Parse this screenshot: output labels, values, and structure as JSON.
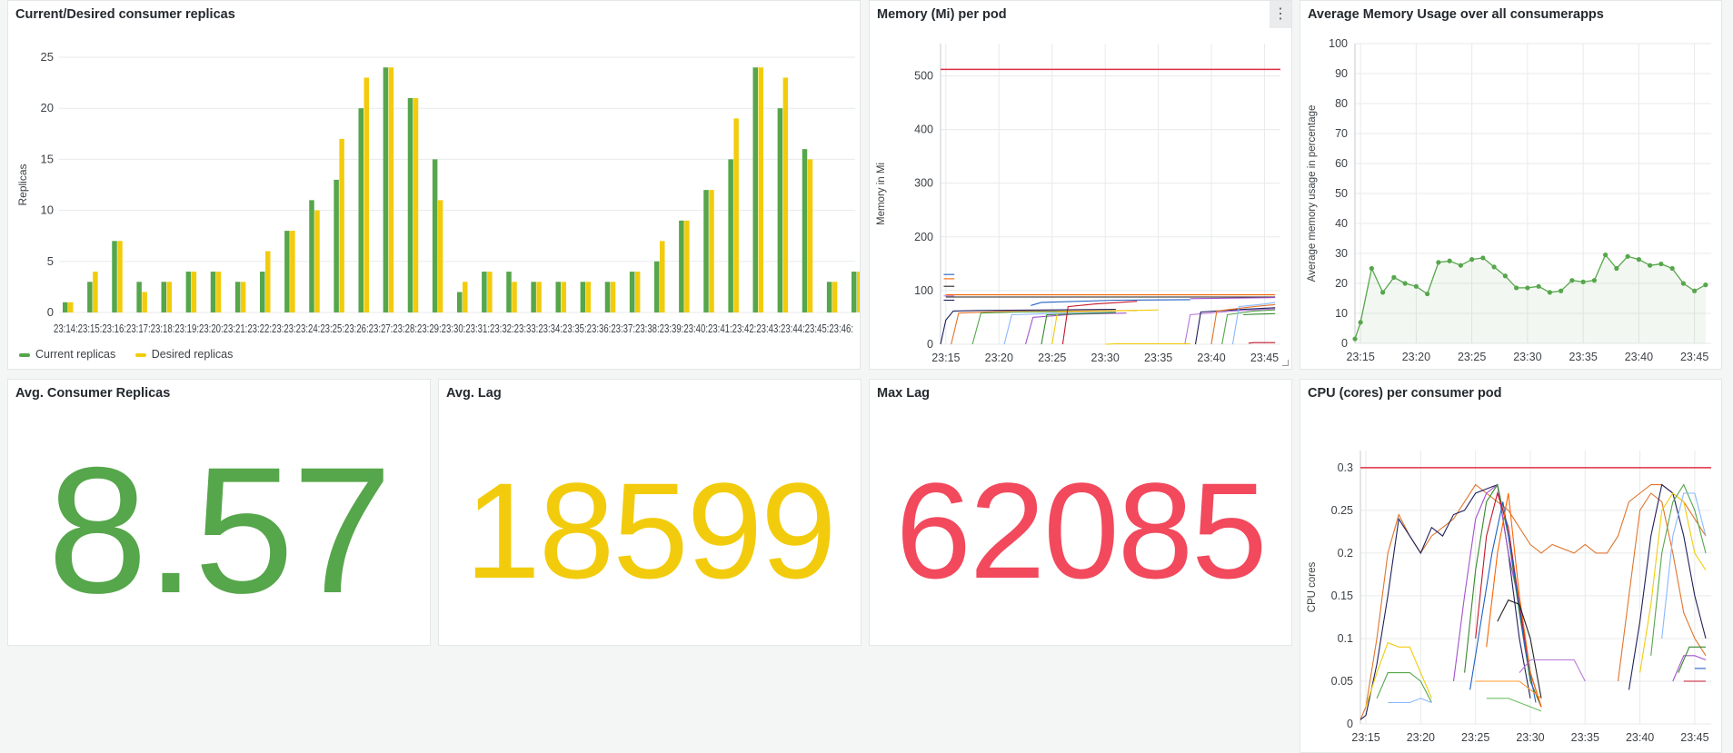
{
  "colors": {
    "green": "#56a64b",
    "yellow": "#f2cc0c",
    "red": "#f2495c",
    "grid": "#e8eaeb",
    "axis_text": "#3d4247"
  },
  "panels": {
    "replicas": {
      "title": "Current/Desired consumer replicas",
      "legend": [
        "Current replicas",
        "Desired replicas"
      ]
    },
    "memory": {
      "title": "Memory (Mi) per pod",
      "menu_icon": "⋮"
    },
    "avg_memory": {
      "title": "Average Memory Usage over all consumerapps"
    },
    "avg_replicas": {
      "title": "Avg. Consumer Replicas",
      "value": "8.57"
    },
    "avg_lag": {
      "title": "Avg. Lag",
      "value": "18599"
    },
    "max_lag": {
      "title": "Max Lag",
      "value": "62085"
    },
    "cpu": {
      "title": "CPU (cores) per consumer pod"
    }
  },
  "chart_data": [
    {
      "type": "bar",
      "title": "Current/Desired consumer replicas",
      "ylabel": "Replicas",
      "ylim": [
        0,
        25
      ],
      "yticks": [
        0,
        5,
        10,
        15,
        20,
        25
      ],
      "categories": [
        "23:14",
        "23:15",
        "23:16",
        "23:17",
        "23:18",
        "23:19",
        "23:20",
        "23:21",
        "23:22",
        "23:23",
        "23:24",
        "23:25",
        "23:26",
        "23:27",
        "23:28",
        "23:29",
        "23:30",
        "23:31",
        "23:32",
        "23:33",
        "23:34",
        "23:35",
        "23:36",
        "23:37",
        "23:38",
        "23:39",
        "23:40",
        "23:41",
        "23:42",
        "23:43",
        "23:44",
        "23:45",
        "23:46"
      ],
      "xtick_text": "23:14:23:15:23:16:23:17:23:18:23:19:23:20:23:21:23:22:23:23:23:24:23:25:23:26:23:27:23:28:23:29:23:30:23:31:23:32:23:33:23:34:23:35:23:36:23:37:23:38:23:39:23:40:23:41:23:42:23:43:23:44:23:45:23:46:",
      "series": [
        {
          "name": "Current replicas",
          "color": "#56a64b",
          "values": [
            1,
            3,
            7,
            3,
            3,
            4,
            4,
            3,
            4,
            8,
            11,
            13,
            20,
            24,
            21,
            15,
            2,
            4,
            4,
            3,
            3,
            3,
            3,
            4,
            5,
            9,
            12,
            15,
            24,
            20,
            16,
            3,
            4
          ]
        },
        {
          "name": "Desired replicas",
          "color": "#f2cc0c",
          "values": [
            1,
            4,
            7,
            2,
            3,
            4,
            4,
            3,
            6,
            8,
            10,
            17,
            23,
            24,
            21,
            11,
            3,
            4,
            3,
            3,
            3,
            3,
            3,
            4,
            7,
            9,
            12,
            19,
            24,
            23,
            15,
            3,
            4
          ]
        }
      ],
      "legend": "bottom-left"
    },
    {
      "type": "line",
      "title": "Memory (Mi) per pod",
      "ylabel": "Memory in Mi",
      "ylim": [
        0,
        560
      ],
      "yticks": [
        0,
        100,
        200,
        300,
        400,
        500
      ],
      "xticks": [
        "23:15",
        "23:20",
        "23:25",
        "23:30",
        "23:35",
        "23:40",
        "23:45"
      ],
      "xrange": [
        14.5,
        46.5
      ],
      "limit_line": {
        "value": 512,
        "color": "#e02f44"
      },
      "series_colors": [
        "#1f1f5c",
        "#e0752d",
        "#56a64b",
        "#8ab8ff",
        "#a352cc",
        "#37872d",
        "#f2cc0c",
        "#c4162a",
        "#1f60c4",
        "#fa6400",
        "#222222",
        "#b877d9"
      ],
      "series": [
        {
          "x": [
            14.5,
            15,
            15.7,
            18,
            25,
            31
          ],
          "y": [
            0,
            45,
            62,
            63,
            64,
            65
          ]
        },
        {
          "x": [
            15.5,
            16.2,
            20,
            27,
            33
          ],
          "y": [
            0,
            58,
            61,
            62,
            63
          ]
        },
        {
          "x": [
            17.5,
            18.3,
            22,
            27
          ],
          "y": [
            0,
            58,
            60,
            61
          ]
        },
        {
          "x": [
            20.5,
            21.2,
            26,
            31
          ],
          "y": [
            0,
            55,
            58,
            60
          ]
        },
        {
          "x": [
            22.5,
            23.2,
            27,
            32
          ],
          "y": [
            0,
            50,
            56,
            58
          ]
        },
        {
          "x": [
            24,
            24.5,
            28,
            31
          ],
          "y": [
            0,
            55,
            57,
            59
          ]
        },
        {
          "x": [
            25,
            25.5,
            30,
            35
          ],
          "y": [
            0,
            60,
            62,
            64
          ]
        },
        {
          "x": [
            26,
            26.5,
            29,
            33
          ],
          "y": [
            0,
            70,
            75,
            80
          ]
        },
        {
          "x": [
            23,
            24,
            31,
            38
          ],
          "y": [
            72,
            78,
            82,
            83
          ]
        },
        {
          "x": [
            15,
            31,
            46
          ],
          "y": [
            92,
            92,
            92
          ]
        },
        {
          "x": [
            15,
            32,
            46
          ],
          "y": [
            88,
            88,
            88
          ]
        },
        {
          "x": [
            37.5,
            38,
            42,
            46
          ],
          "y": [
            0,
            55,
            62,
            66
          ]
        },
        {
          "x": [
            38.5,
            39,
            43,
            46
          ],
          "y": [
            0,
            60,
            65,
            68
          ]
        },
        {
          "x": [
            40,
            40.5,
            44,
            46
          ],
          "y": [
            0,
            62,
            70,
            74
          ]
        },
        {
          "x": [
            41,
            41.5,
            44,
            46
          ],
          "y": [
            0,
            55,
            62,
            64
          ]
        },
        {
          "x": [
            42,
            42.6,
            45,
            46
          ],
          "y": [
            0,
            70,
            75,
            78
          ]
        },
        {
          "x": [
            38,
            42,
            46
          ],
          "y": [
            85,
            86,
            87
          ]
        },
        {
          "x": [
            43,
            44,
            46
          ],
          "y": [
            55,
            56,
            57
          ]
        },
        {
          "x": [
            30,
            31,
            38
          ],
          "y": [
            0,
            1,
            1
          ]
        },
        {
          "x": [
            43.5,
            44,
            46
          ],
          "y": [
            2,
            3,
            3
          ]
        },
        {
          "x": [
            14.8,
            15.8
          ],
          "y": [
            130,
            130
          ]
        },
        {
          "x": [
            14.8,
            15.8
          ],
          "y": [
            122,
            122
          ]
        },
        {
          "x": [
            14.8,
            15.8
          ],
          "y": [
            108,
            108
          ]
        },
        {
          "x": [
            14.8,
            15.8
          ],
          "y": [
            90,
            90
          ]
        },
        {
          "x": [
            14.8,
            15.8
          ],
          "y": [
            82,
            82
          ]
        }
      ]
    },
    {
      "type": "area",
      "title": "Average Memory Usage over all consumerapps",
      "ylabel": "Average memory usage in percentage",
      "ylim": [
        0,
        100
      ],
      "yticks": [
        0,
        10,
        20,
        30,
        40,
        50,
        60,
        70,
        80,
        90,
        100
      ],
      "xticks": [
        "23:15",
        "23:20",
        "23:25",
        "23:30",
        "23:35",
        "23:40",
        "23:45"
      ],
      "xrange": [
        14.5,
        46.5
      ],
      "series": [
        {
          "name": "Average memory usage",
          "color": "#56a64b",
          "x": [
            14.5,
            15,
            16,
            17,
            18,
            19,
            20,
            21,
            22,
            23,
            24,
            25,
            26,
            27,
            28,
            29,
            30,
            31,
            32,
            33,
            34,
            35,
            36,
            37,
            38,
            39,
            40,
            41,
            42,
            43,
            44,
            45,
            46
          ],
          "y": [
            1.5,
            7,
            25,
            17,
            22,
            20,
            19,
            16.5,
            27,
            27.5,
            26,
            28,
            28.5,
            25.5,
            22.5,
            18.5,
            18.5,
            19,
            17,
            17.5,
            21,
            20.5,
            21,
            29.5,
            25,
            29,
            28,
            26,
            26.5,
            25,
            20,
            17.5,
            19.5
          ]
        }
      ]
    },
    {
      "type": "line",
      "title": "CPU (cores) per consumer pod",
      "ylabel": "CPU cores",
      "ylim": [
        0,
        0.32
      ],
      "yticks": [
        0,
        0.05,
        0.1,
        0.15,
        0.2,
        0.25,
        0.3
      ],
      "xticks": [
        "23:15",
        "23:20",
        "23:25",
        "23:30",
        "23:35",
        "23:40",
        "23:45"
      ],
      "xrange": [
        14.5,
        46.5
      ],
      "limit_line": {
        "value": 0.3,
        "color": "#e02f44"
      },
      "series_colors": [
        "#e0752d",
        "#1f1f5c",
        "#f2cc0c",
        "#56a64b",
        "#8ab8ff",
        "#a352cc",
        "#37872d",
        "#c4162a",
        "#1f60c4",
        "#fa6400",
        "#222222",
        "#ff9830",
        "#b877d9",
        "#73bf69"
      ],
      "series": [
        {
          "x": [
            14.5,
            15,
            16,
            17,
            18,
            19,
            20,
            21,
            22,
            23,
            24,
            25,
            26,
            27,
            28,
            29,
            30,
            31,
            32,
            33,
            34,
            35,
            36,
            37,
            38,
            39,
            40,
            41,
            42,
            43,
            44,
            45,
            46
          ],
          "y": [
            0.005,
            0.02,
            0.1,
            0.2,
            0.245,
            0.22,
            0.2,
            0.22,
            0.23,
            0.24,
            0.26,
            0.28,
            0.27,
            0.26,
            0.25,
            0.23,
            0.21,
            0.2,
            0.21,
            0.205,
            0.2,
            0.21,
            0.2,
            0.2,
            0.22,
            0.26,
            0.27,
            0.28,
            0.28,
            0.27,
            0.26,
            0.24,
            0.22
          ]
        },
        {
          "x": [
            14.5,
            15,
            16,
            17,
            18,
            19,
            20,
            21,
            22,
            23,
            24,
            25,
            26,
            27,
            28,
            29,
            30
          ],
          "y": [
            0.005,
            0.01,
            0.07,
            0.15,
            0.24,
            0.22,
            0.2,
            0.23,
            0.22,
            0.245,
            0.25,
            0.27,
            0.275,
            0.28,
            0.2,
            0.1,
            0.03
          ]
        },
        {
          "x": [
            15,
            16,
            17,
            18,
            19,
            20,
            21
          ],
          "y": [
            0.02,
            0.06,
            0.095,
            0.09,
            0.09,
            0.06,
            0.03
          ]
        },
        {
          "x": [
            16,
            17,
            18,
            19,
            20,
            21
          ],
          "y": [
            0.03,
            0.06,
            0.06,
            0.06,
            0.05,
            0.025
          ]
        },
        {
          "x": [
            17,
            18,
            19,
            20,
            21
          ],
          "y": [
            0.025,
            0.025,
            0.025,
            0.03,
            0.025
          ]
        },
        {
          "x": [
            23,
            24,
            25,
            26,
            27,
            28,
            29,
            30,
            31
          ],
          "y": [
            0.05,
            0.15,
            0.24,
            0.27,
            0.28,
            0.2,
            0.14,
            0.05,
            0.02
          ]
        },
        {
          "x": [
            24,
            25,
            26,
            27,
            28,
            29,
            30,
            31
          ],
          "y": [
            0.06,
            0.18,
            0.26,
            0.28,
            0.22,
            0.13,
            0.05,
            0.02
          ]
        },
        {
          "x": [
            25,
            26,
            27,
            28,
            29,
            30,
            31
          ],
          "y": [
            0.1,
            0.22,
            0.27,
            0.23,
            0.14,
            0.06,
            0.02
          ]
        },
        {
          "x": [
            24.5,
            25.5,
            26.5,
            27.5,
            28.5,
            29.5,
            30.5
          ],
          "y": [
            0.04,
            0.12,
            0.2,
            0.26,
            0.18,
            0.09,
            0.025
          ]
        },
        {
          "x": [
            26,
            27,
            28,
            29,
            30,
            31
          ],
          "y": [
            0.09,
            0.2,
            0.27,
            0.15,
            0.06,
            0.02
          ]
        },
        {
          "x": [
            27,
            28,
            29,
            30,
            31
          ],
          "y": [
            0.12,
            0.145,
            0.14,
            0.1,
            0.03
          ]
        },
        {
          "x": [
            25,
            26,
            27,
            28,
            29,
            30,
            31
          ],
          "y": [
            0.05,
            0.05,
            0.05,
            0.05,
            0.05,
            0.04,
            0.03
          ]
        },
        {
          "x": [
            29,
            30,
            31,
            32,
            33,
            34,
            35
          ],
          "y": [
            0.06,
            0.075,
            0.075,
            0.075,
            0.075,
            0.075,
            0.05
          ]
        },
        {
          "x": [
            26,
            27,
            28,
            29,
            30,
            31
          ],
          "y": [
            0.03,
            0.03,
            0.03,
            0.025,
            0.02,
            0.015
          ]
        },
        {
          "x": [
            38,
            39,
            40,
            41,
            42,
            43,
            44,
            45,
            46
          ],
          "y": [
            0.05,
            0.15,
            0.25,
            0.27,
            0.26,
            0.2,
            0.13,
            0.1,
            0.08
          ]
        },
        {
          "x": [
            39,
            40,
            41,
            42,
            43,
            44,
            45,
            46
          ],
          "y": [
            0.04,
            0.12,
            0.22,
            0.28,
            0.27,
            0.22,
            0.15,
            0.1
          ]
        },
        {
          "x": [
            40,
            41,
            42,
            43,
            44,
            45,
            46
          ],
          "y": [
            0.06,
            0.14,
            0.25,
            0.27,
            0.26,
            0.2,
            0.18
          ]
        },
        {
          "x": [
            41,
            42,
            43,
            44,
            45,
            46
          ],
          "y": [
            0.08,
            0.2,
            0.26,
            0.28,
            0.25,
            0.2
          ]
        },
        {
          "x": [
            42,
            43,
            44,
            45,
            46
          ],
          "y": [
            0.1,
            0.22,
            0.27,
            0.27,
            0.22
          ]
        },
        {
          "x": [
            43,
            44,
            45,
            46
          ],
          "y": [
            0.05,
            0.08,
            0.08,
            0.075
          ]
        },
        {
          "x": [
            43.5,
            44.5,
            45.5,
            46
          ],
          "y": [
            0.06,
            0.09,
            0.09,
            0.09
          ]
        },
        {
          "x": [
            44,
            45,
            46
          ],
          "y": [
            0.05,
            0.05,
            0.05
          ]
        },
        {
          "x": [
            45,
            46
          ],
          "y": [
            0.065,
            0.065
          ]
        }
      ]
    }
  ]
}
